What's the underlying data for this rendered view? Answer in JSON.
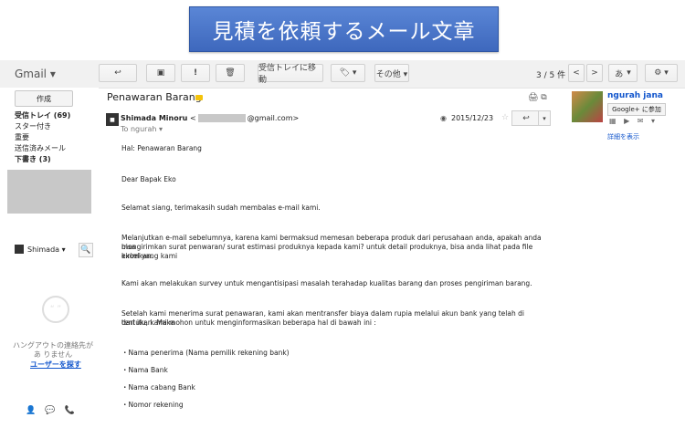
{
  "banner": {
    "text": "見積を依頼するメール文章"
  },
  "toolbar": {
    "app_name": "Gmail ▾",
    "back": "↩",
    "archive": "▣",
    "spam": "!",
    "delete": "🗑",
    "move_to_inbox": "受信トレイに移動",
    "labels": "🏷 ▾",
    "more": "その他 ▾",
    "page_count": "3 / 5 件",
    "prev": "<",
    "next": ">",
    "input_tools": "あ",
    "input_tools_arrow": "▾",
    "settings": "⚙ ▾"
  },
  "sidebar": {
    "compose": "作成",
    "items": [
      {
        "label": "受信トレイ (69)",
        "bold": true
      },
      {
        "label": "スター付き",
        "bold": false
      },
      {
        "label": "重要",
        "bold": false
      },
      {
        "label": "送信済みメール",
        "bold": false
      },
      {
        "label": "下書き (3)",
        "bold": true
      }
    ],
    "chat_user": "Shimada ▾",
    "chat_search": "🔍",
    "hangout_text": "ハングアウトの連絡先があ りません",
    "find_user": "ユーザーを探す",
    "bottom_icons": [
      "👤",
      "💬",
      "📞"
    ]
  },
  "email": {
    "subject": "Penawaran Barang",
    "sender_name": "Shimada Minoru",
    "sender_domain": "@gmail.com>",
    "sender_open": "<",
    "to": "To ngurah ▾",
    "date": "2015/12/23",
    "icons": "🖨 ⧉",
    "body": [
      "Hal: Penawaran Barang",
      "Dear Bapak Eko",
      "Selamat siang, terimakasih sudah membalas e-mail kami.",
      "Melanjutkan e-mail sebelumnya, karena kami bermaksud memesan beberapa produk dari perusahaan anda, apakah anda bisa",
      "mengirimkan surat penwaran/ surat estimasi produknya kepada kami? untuk detail produknya, bisa anda lihat pada file excel yang kami",
      "kirimkan.",
      "Kami akan melakukan survey untuk mengantisipasi masalah terahadap kualitas barang dan proses pengiriman barang.",
      "Setelah kami menerima surat penawaran, kami akan mentransfer biaya dalam rupia melalui akun bank yang telah di tentukan. Maka",
      "dari itu, kami mohon untuk menginformasikan beberapa hal di bawah ini :",
      "・Nama penerima (Nama pemilik rekening bank)",
      "・Nama Bank",
      "・Nama cabang Bank",
      "・Nomor rekening"
    ]
  },
  "contact": {
    "name": "ngurah jana",
    "gplus": "Google+ に参加",
    "icons": "▦ ▶ ✉ ▾",
    "details": "詳細を表示"
  }
}
